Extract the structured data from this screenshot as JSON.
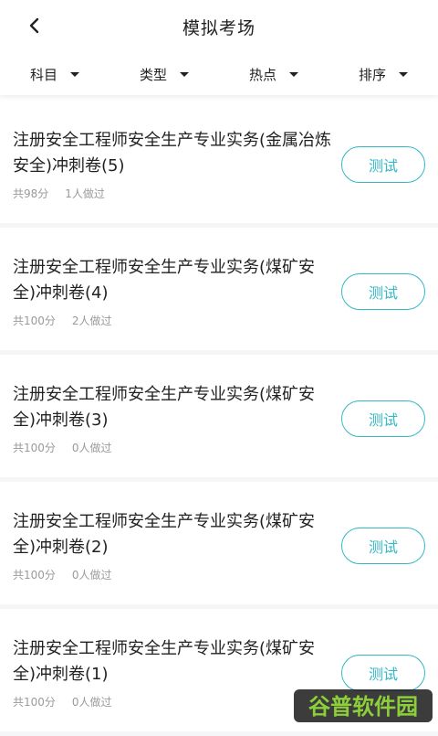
{
  "header": {
    "title": "模拟考场"
  },
  "filters": [
    {
      "label": "科目"
    },
    {
      "label": "类型"
    },
    {
      "label": "热点"
    },
    {
      "label": "排序"
    }
  ],
  "exams": [
    {
      "title": "注册安全工程师安全生产专业实务(金属冶炼安全)冲刺卷(5)",
      "score": "共98分",
      "taken": "1人做过",
      "button_label": "测试"
    },
    {
      "title": "注册安全工程师安全生产专业实务(煤矿安全)冲刺卷(4)",
      "score": "共100分",
      "taken": "2人做过",
      "button_label": "测试"
    },
    {
      "title": "注册安全工程师安全生产专业实务(煤矿安全)冲刺卷(3)",
      "score": "共100分",
      "taken": "0人做过",
      "button_label": "测试"
    },
    {
      "title": "注册安全工程师安全生产专业实务(煤矿安全)冲刺卷(2)",
      "score": "共100分",
      "taken": "0人做过",
      "button_label": "测试"
    },
    {
      "title": "注册安全工程师安全生产专业实务(煤矿安全)冲刺卷(1)",
      "score": "共100分",
      "taken": "0人做过",
      "button_label": "测试"
    }
  ],
  "watermark": {
    "text": "谷普软件园"
  },
  "colors": {
    "accent": "#33b8c6",
    "meta_text": "#9a9a9a",
    "divider": "#f5f6f7"
  },
  "icons": {
    "back": "chevron-left-icon",
    "dropdown": "caret-down-icon"
  }
}
